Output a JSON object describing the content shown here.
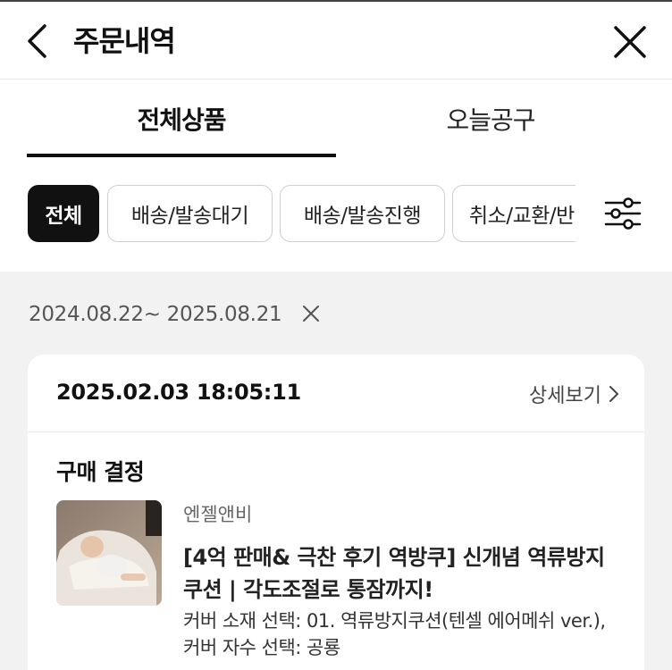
{
  "header": {
    "title": "주문내역"
  },
  "tabs": [
    {
      "label": "전체상품",
      "active": true
    },
    {
      "label": "오늘공구",
      "active": false
    }
  ],
  "filters": {
    "chips": [
      {
        "label": "전체",
        "active": true
      },
      {
        "label": "배송/발송대기",
        "active": false
      },
      {
        "label": "배송/발송진행",
        "active": false
      },
      {
        "label": "취소/교환/반",
        "active": false
      }
    ]
  },
  "date_range": {
    "text": "2024.08.22~ 2025.08.21"
  },
  "order": {
    "datetime": "2025.02.03 18:05:11",
    "detail_label": "상세보기",
    "status": "구매 결정",
    "seller": "엔젤앤비",
    "product_name": "[4억 판매& 극찬 후기 역방쿠] 신개념 역류방지 쿠션 | 각도조절로 통잠까지!",
    "option": "커버 소재 선택: 01. 역류방지쿠션(텐셀 에어메쉬 ver.), 커버 자수 선택: 공룡"
  },
  "colors": {
    "text_primary": "#111111",
    "chip_active_bg": "#111111",
    "page_bg": "#f2f2f2"
  },
  "icons": {
    "back": "chevron-left-icon",
    "close": "close-icon",
    "settings": "sliders-icon",
    "date_clear": "close-icon",
    "detail": "chevron-right-icon"
  }
}
